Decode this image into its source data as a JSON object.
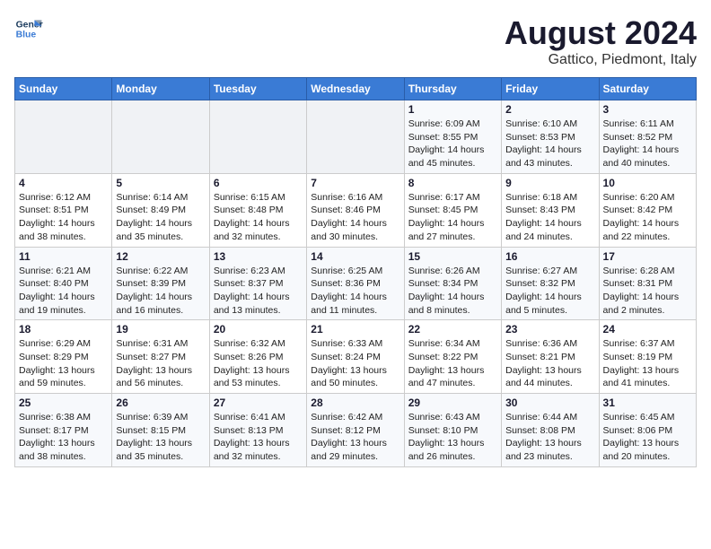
{
  "header": {
    "logo_line1": "General",
    "logo_line2": "Blue",
    "main_title": "August 2024",
    "subtitle": "Gattico, Piedmont, Italy"
  },
  "weekdays": [
    "Sunday",
    "Monday",
    "Tuesday",
    "Wednesday",
    "Thursday",
    "Friday",
    "Saturday"
  ],
  "weeks": [
    [
      {
        "day": "",
        "info": ""
      },
      {
        "day": "",
        "info": ""
      },
      {
        "day": "",
        "info": ""
      },
      {
        "day": "",
        "info": ""
      },
      {
        "day": "1",
        "info": "Sunrise: 6:09 AM\nSunset: 8:55 PM\nDaylight: 14 hours and 45 minutes."
      },
      {
        "day": "2",
        "info": "Sunrise: 6:10 AM\nSunset: 8:53 PM\nDaylight: 14 hours and 43 minutes."
      },
      {
        "day": "3",
        "info": "Sunrise: 6:11 AM\nSunset: 8:52 PM\nDaylight: 14 hours and 40 minutes."
      }
    ],
    [
      {
        "day": "4",
        "info": "Sunrise: 6:12 AM\nSunset: 8:51 PM\nDaylight: 14 hours and 38 minutes."
      },
      {
        "day": "5",
        "info": "Sunrise: 6:14 AM\nSunset: 8:49 PM\nDaylight: 14 hours and 35 minutes."
      },
      {
        "day": "6",
        "info": "Sunrise: 6:15 AM\nSunset: 8:48 PM\nDaylight: 14 hours and 32 minutes."
      },
      {
        "day": "7",
        "info": "Sunrise: 6:16 AM\nSunset: 8:46 PM\nDaylight: 14 hours and 30 minutes."
      },
      {
        "day": "8",
        "info": "Sunrise: 6:17 AM\nSunset: 8:45 PM\nDaylight: 14 hours and 27 minutes."
      },
      {
        "day": "9",
        "info": "Sunrise: 6:18 AM\nSunset: 8:43 PM\nDaylight: 14 hours and 24 minutes."
      },
      {
        "day": "10",
        "info": "Sunrise: 6:20 AM\nSunset: 8:42 PM\nDaylight: 14 hours and 22 minutes."
      }
    ],
    [
      {
        "day": "11",
        "info": "Sunrise: 6:21 AM\nSunset: 8:40 PM\nDaylight: 14 hours and 19 minutes."
      },
      {
        "day": "12",
        "info": "Sunrise: 6:22 AM\nSunset: 8:39 PM\nDaylight: 14 hours and 16 minutes."
      },
      {
        "day": "13",
        "info": "Sunrise: 6:23 AM\nSunset: 8:37 PM\nDaylight: 14 hours and 13 minutes."
      },
      {
        "day": "14",
        "info": "Sunrise: 6:25 AM\nSunset: 8:36 PM\nDaylight: 14 hours and 11 minutes."
      },
      {
        "day": "15",
        "info": "Sunrise: 6:26 AM\nSunset: 8:34 PM\nDaylight: 14 hours and 8 minutes."
      },
      {
        "day": "16",
        "info": "Sunrise: 6:27 AM\nSunset: 8:32 PM\nDaylight: 14 hours and 5 minutes."
      },
      {
        "day": "17",
        "info": "Sunrise: 6:28 AM\nSunset: 8:31 PM\nDaylight: 14 hours and 2 minutes."
      }
    ],
    [
      {
        "day": "18",
        "info": "Sunrise: 6:29 AM\nSunset: 8:29 PM\nDaylight: 13 hours and 59 minutes."
      },
      {
        "day": "19",
        "info": "Sunrise: 6:31 AM\nSunset: 8:27 PM\nDaylight: 13 hours and 56 minutes."
      },
      {
        "day": "20",
        "info": "Sunrise: 6:32 AM\nSunset: 8:26 PM\nDaylight: 13 hours and 53 minutes."
      },
      {
        "day": "21",
        "info": "Sunrise: 6:33 AM\nSunset: 8:24 PM\nDaylight: 13 hours and 50 minutes."
      },
      {
        "day": "22",
        "info": "Sunrise: 6:34 AM\nSunset: 8:22 PM\nDaylight: 13 hours and 47 minutes."
      },
      {
        "day": "23",
        "info": "Sunrise: 6:36 AM\nSunset: 8:21 PM\nDaylight: 13 hours and 44 minutes."
      },
      {
        "day": "24",
        "info": "Sunrise: 6:37 AM\nSunset: 8:19 PM\nDaylight: 13 hours and 41 minutes."
      }
    ],
    [
      {
        "day": "25",
        "info": "Sunrise: 6:38 AM\nSunset: 8:17 PM\nDaylight: 13 hours and 38 minutes."
      },
      {
        "day": "26",
        "info": "Sunrise: 6:39 AM\nSunset: 8:15 PM\nDaylight: 13 hours and 35 minutes."
      },
      {
        "day": "27",
        "info": "Sunrise: 6:41 AM\nSunset: 8:13 PM\nDaylight: 13 hours and 32 minutes."
      },
      {
        "day": "28",
        "info": "Sunrise: 6:42 AM\nSunset: 8:12 PM\nDaylight: 13 hours and 29 minutes."
      },
      {
        "day": "29",
        "info": "Sunrise: 6:43 AM\nSunset: 8:10 PM\nDaylight: 13 hours and 26 minutes."
      },
      {
        "day": "30",
        "info": "Sunrise: 6:44 AM\nSunset: 8:08 PM\nDaylight: 13 hours and 23 minutes."
      },
      {
        "day": "31",
        "info": "Sunrise: 6:45 AM\nSunset: 8:06 PM\nDaylight: 13 hours and 20 minutes."
      }
    ]
  ]
}
